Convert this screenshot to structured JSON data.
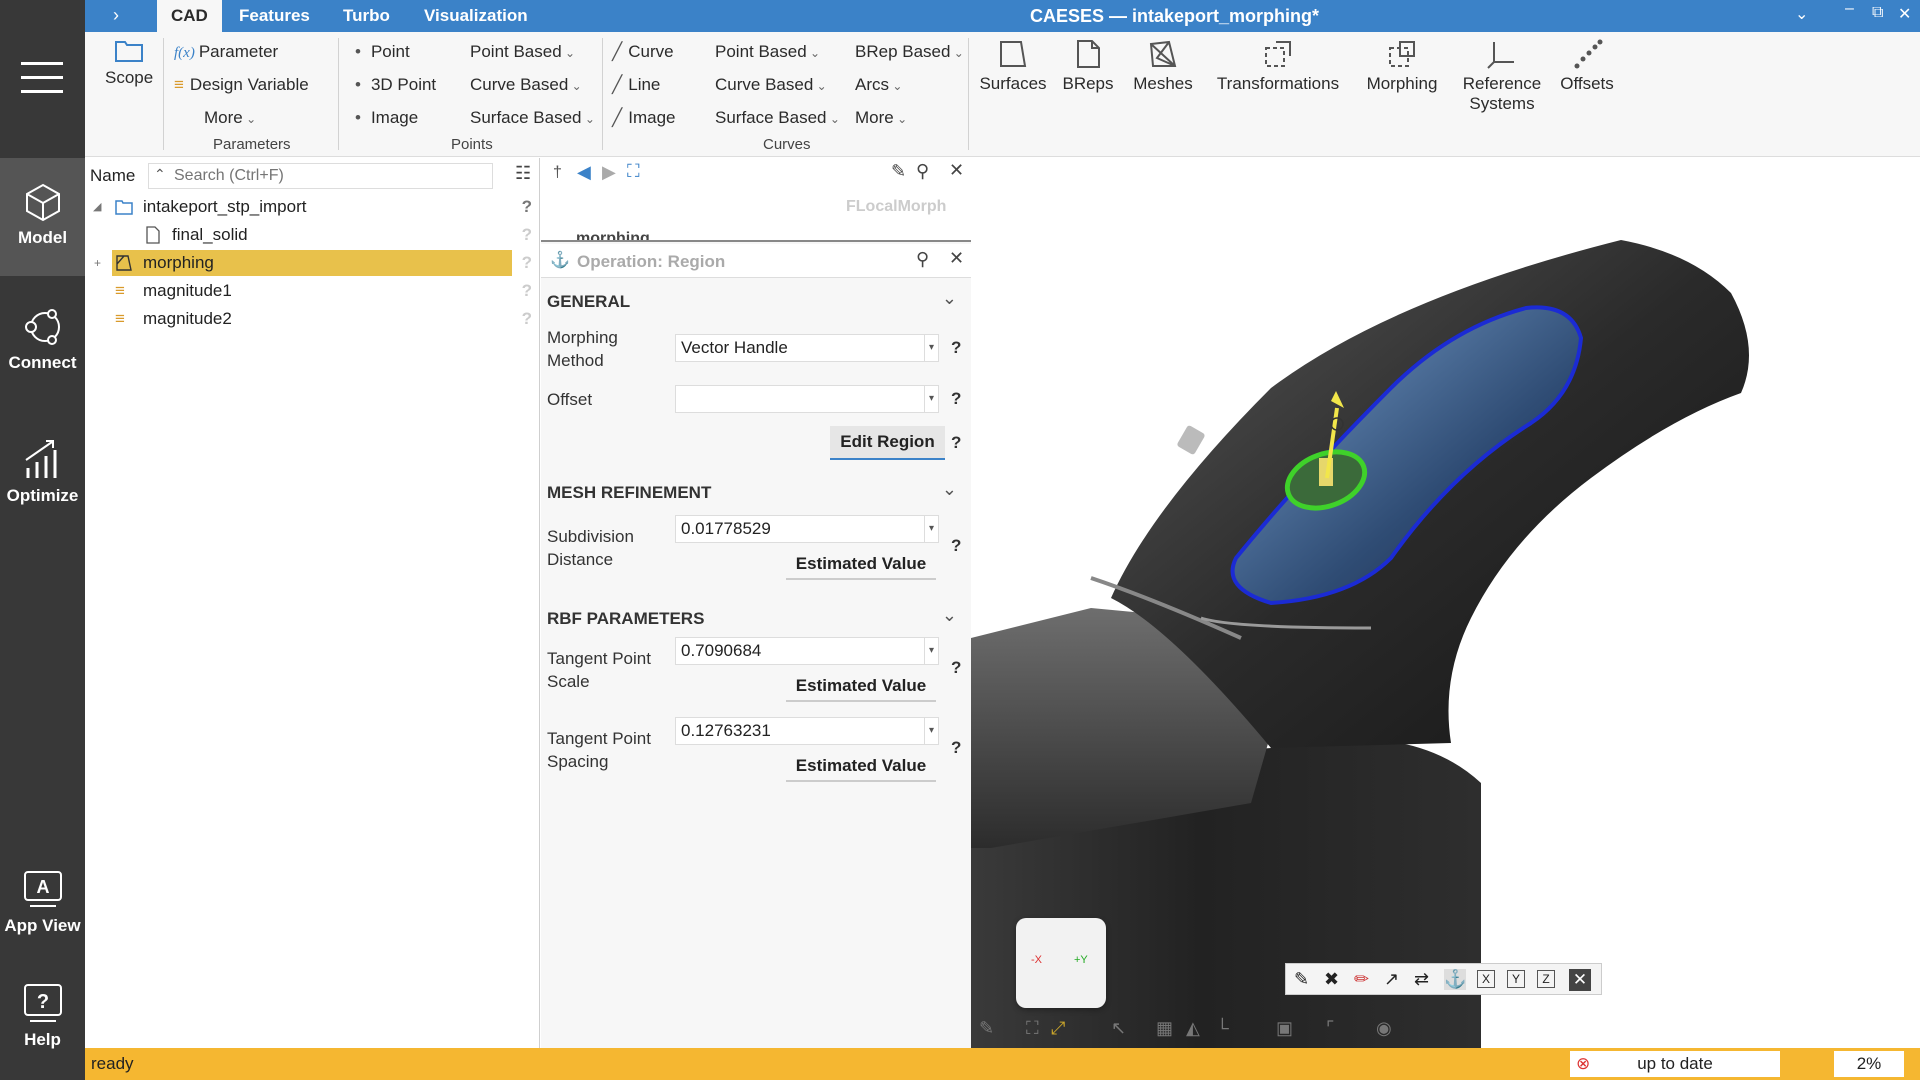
{
  "nav": {
    "items": [
      {
        "label": "Model"
      },
      {
        "label": "Connect"
      },
      {
        "label": "Optimize"
      },
      {
        "label": "App View"
      },
      {
        "label": "Help"
      }
    ]
  },
  "titlebar": {
    "tabs": [
      "CAD",
      "Features",
      "Turbo",
      "Visualization"
    ],
    "title": "CAESES — intakeport_morphing*"
  },
  "ribbon": {
    "scope": "Scope",
    "parameter": "Parameter",
    "parameter_prefix": "f(x)",
    "design_variable": "Design Variable",
    "more": "More",
    "group_parameters": "Parameters",
    "point": "Point",
    "point3d": "3D Point",
    "image": "Image",
    "point_based": "Point Based",
    "curve_based": "Curve Based",
    "surface_based": "Surface Based",
    "group_points": "Points",
    "curve": "Curve",
    "line": "Line",
    "curves_image": "Image",
    "curves_point_based": "Point Based",
    "curves_curve_based": "Curve Based",
    "curves_surface_based": "Surface Based",
    "brep_based": "BRep Based",
    "arcs": "Arcs",
    "curves_more": "More",
    "group_curves": "Curves",
    "surfaces": "Surfaces",
    "breps": "BReps",
    "meshes": "Meshes",
    "transformations": "Transformations",
    "morphing": "Morphing",
    "reference_systems_1": "Reference",
    "reference_systems_2": "Systems",
    "offsets": "Offsets"
  },
  "tree": {
    "name_label": "Name",
    "search_placeholder": "Search (Ctrl+F)",
    "items": [
      {
        "label": "intakeport_stp_import"
      },
      {
        "label": "final_solid"
      },
      {
        "label": "morphing"
      },
      {
        "label": "magnitude1"
      },
      {
        "label": "magnitude2"
      }
    ],
    "help": "?"
  },
  "props": {
    "object_type": "FLocalMorph",
    "object_name": "morphing",
    "operation_title": "Operation: Region",
    "general": {
      "header": "GENERAL",
      "morphing_method_label_1": "Morphing",
      "morphing_method_label_2": "Method",
      "morphing_method_value": "Vector Handle",
      "offset_label": "Offset",
      "offset_value": "",
      "edit_region": "Edit Region"
    },
    "mesh": {
      "header": "MESH REFINEMENT",
      "subdiv_label_1": "Subdivision",
      "subdiv_label_2": "Distance",
      "subdiv_value": "0.01778529",
      "estimated": "Estimated Value"
    },
    "rbf": {
      "header": "RBF PARAMETERS",
      "tps_label_1": "Tangent Point",
      "tps_label_2": "Scale",
      "tps_value": "0.7090684",
      "tpsp_label_1": "Tangent Point",
      "tpsp_label_2": "Spacing",
      "tpsp_value": "0.12763231",
      "estimated": "Estimated Value"
    },
    "help": "?"
  },
  "view": {
    "cube_x": "-X",
    "cube_y": "+Y",
    "tool_x": "X",
    "tool_y": "Y",
    "tool_z": "Z"
  },
  "status": {
    "text": "ready",
    "sync": "up to date",
    "progress": "2%"
  },
  "colors": {
    "titlebar": "#3b82c8",
    "leftnav": "#383838",
    "statusbar": "#f5b731",
    "selection": "#e8c14b",
    "region_outline": "#1b2bd4",
    "handle": "#3fd12a"
  }
}
